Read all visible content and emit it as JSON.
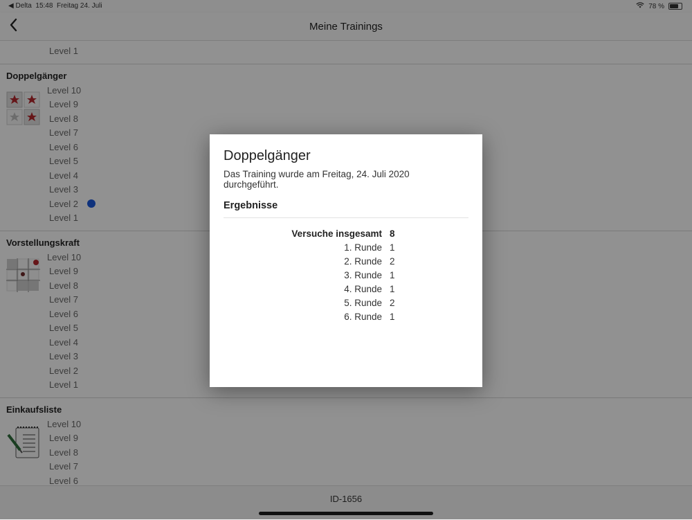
{
  "status_bar": {
    "carrier": "◀ Delta",
    "time": "15:48",
    "date": "Freitag 24. Juli",
    "battery": "78 %",
    "battery_level": 0.78
  },
  "nav": {
    "back_icon": "chevron-left-icon",
    "title": "Meine Trainings"
  },
  "sections": [
    {
      "title": "",
      "levels": [
        "Level 1"
      ]
    },
    {
      "title": "Doppelgänger",
      "levels": [
        "Level 10",
        "Level 9",
        "Level 8",
        "Level 7",
        "Level 6",
        "Level 5",
        "Level 4",
        "Level 3",
        "Level 2",
        "Level 1"
      ],
      "marked_level": "Level 2"
    },
    {
      "title": "Vorstellungskraft",
      "levels": [
        "Level 10",
        "Level 9",
        "Level 8",
        "Level 7",
        "Level 6",
        "Level 5",
        "Level 4",
        "Level 3",
        "Level 2",
        "Level 1"
      ]
    },
    {
      "title": "Einkaufsliste",
      "levels": [
        "Level 10",
        "Level 9",
        "Level 8",
        "Level 7",
        "Level 6"
      ]
    }
  ],
  "footer": {
    "id": "ID-1656"
  },
  "modal": {
    "title": "Doppelgänger",
    "description": "Das Training wurde am Freitag, 24. Juli 2020 durchgeführt.",
    "results_heading": "Ergebnisse",
    "total_label": "Versuche insgesamt",
    "total_value": "8",
    "rounds": [
      {
        "label": "1. Runde",
        "value": "1"
      },
      {
        "label": "2. Runde",
        "value": "2"
      },
      {
        "label": "3. Runde",
        "value": "1"
      },
      {
        "label": "4. Runde",
        "value": "1"
      },
      {
        "label": "5. Runde",
        "value": "2"
      },
      {
        "label": "6. Runde",
        "value": "1"
      }
    ]
  },
  "colors": {
    "marker_dot": "#1a56d6",
    "overlay": "rgba(0,0,0,0.42)"
  }
}
